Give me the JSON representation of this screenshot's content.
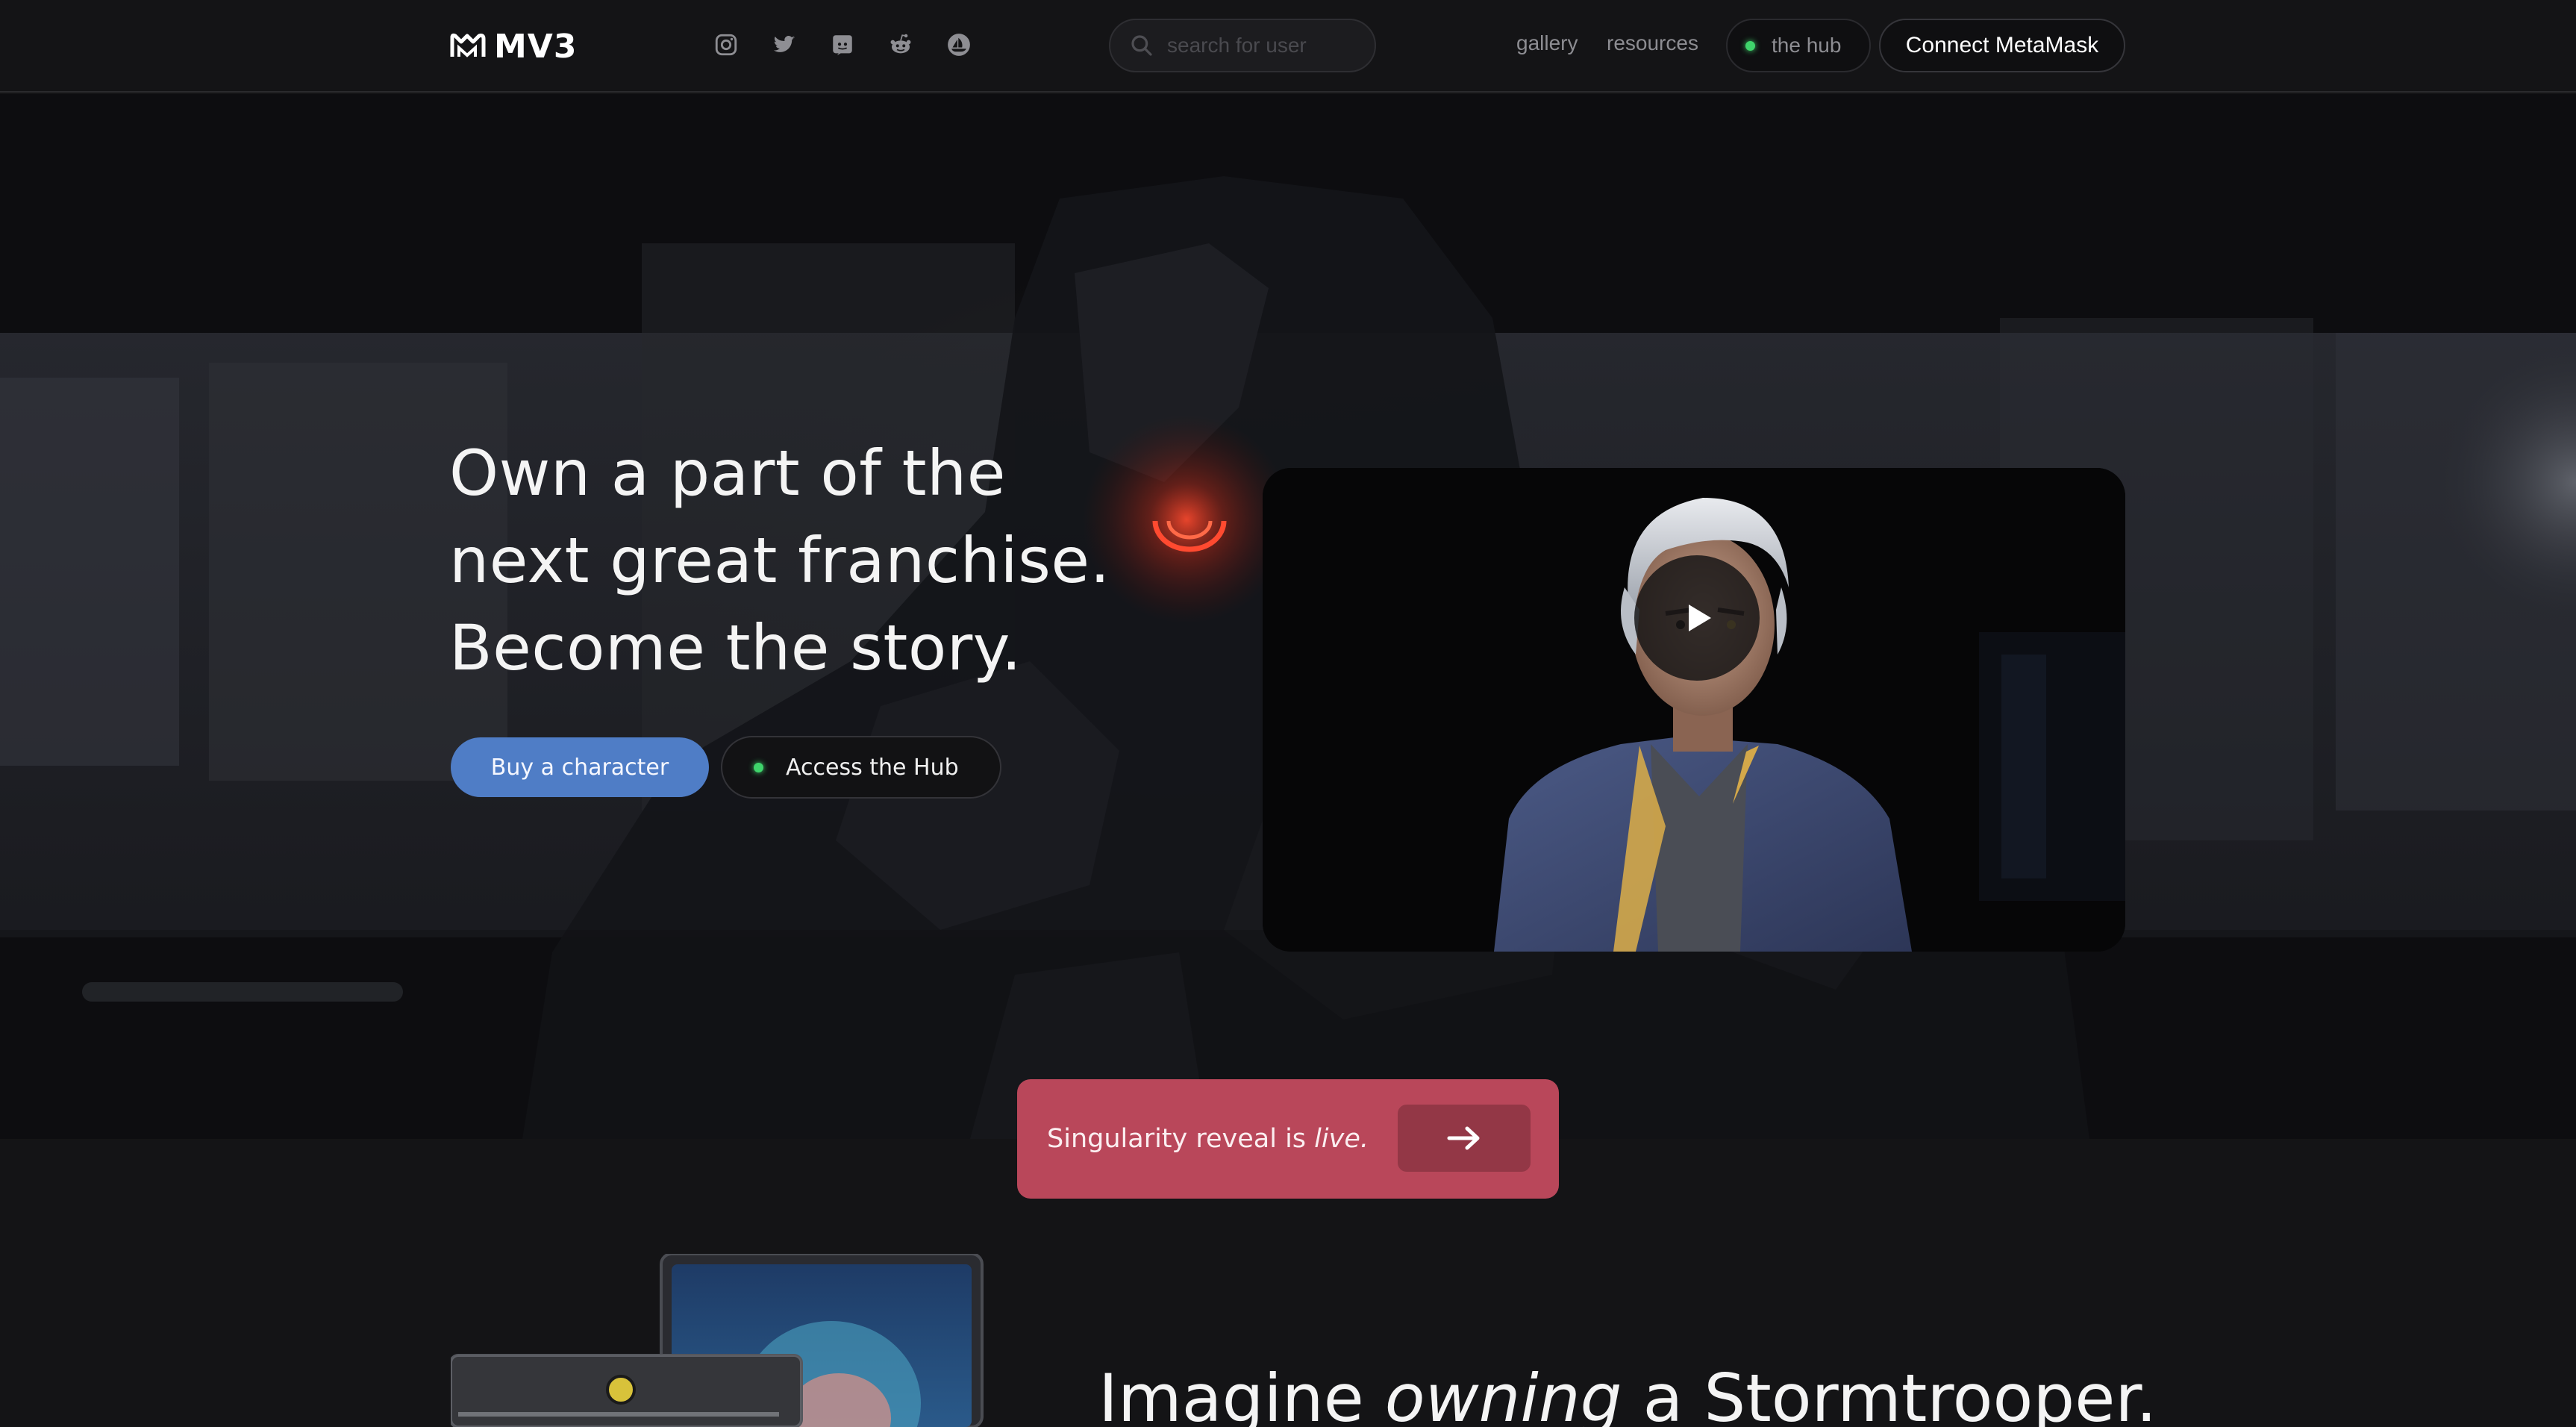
{
  "nav": {
    "logo_text": "MV3",
    "socials": [
      "instagram-icon",
      "twitter-icon",
      "discord-icon",
      "reddit-icon",
      "opensea-icon"
    ],
    "search_placeholder": "search for user",
    "links": {
      "gallery": "gallery",
      "resources": "resources",
      "hub": "the hub"
    },
    "connect_label": "Connect MetaMask"
  },
  "hero": {
    "headline": [
      "Own a part of the",
      "next great franchise.",
      "Become the story."
    ],
    "buy_label": "Buy a character",
    "hub_label": "Access the Hub"
  },
  "banner": {
    "text": "Singularity reveal is ",
    "emphasis": "live."
  },
  "feature": {
    "pre": "Imagine ",
    "emphasis": "owning",
    "post": " a Stormtrooper."
  },
  "colors": {
    "accent_blue": "#4f7dc6",
    "banner_red": "#b9475a",
    "status_green": "#3fd46b",
    "background": "#141416"
  }
}
